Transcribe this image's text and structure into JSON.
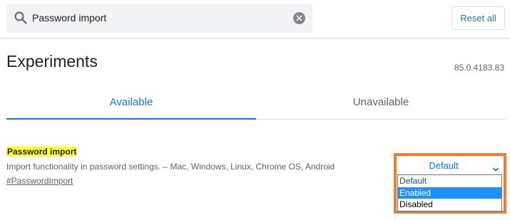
{
  "search": {
    "value": "Password import"
  },
  "header": {
    "reset_label": "Reset all"
  },
  "page": {
    "title": "Experiments",
    "version": "85.0.4183.83"
  },
  "tabs": [
    {
      "label": "Available",
      "active": true
    },
    {
      "label": "Unavailable",
      "active": false
    }
  ],
  "flag": {
    "title": "Password import",
    "description": "Import functionality in password settings. – Mac, Windows, Linux, Chrome OS, Android",
    "link": "#PasswordImport"
  },
  "select": {
    "current": "Default",
    "options": [
      {
        "label": "Default",
        "selected": false
      },
      {
        "label": "Enabled",
        "selected": true
      },
      {
        "label": "Disabled",
        "selected": false
      }
    ]
  },
  "colors": {
    "accent": "#1a73e8",
    "highlight": "#ffff33",
    "annotation_border": "#ed7d31",
    "option_selected": "#1e90ff"
  },
  "icons": [
    "search-icon",
    "clear-icon",
    "chevron-down-icon"
  ]
}
